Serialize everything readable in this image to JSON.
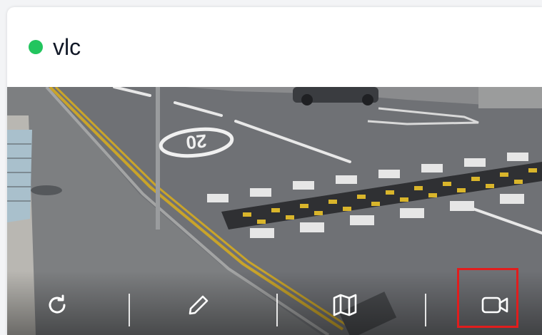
{
  "camera": {
    "name": "vlc",
    "status_color": "#22c55e"
  },
  "feed": {
    "road_marking": "20"
  },
  "toolbar": {
    "items": [
      {
        "icon": "refresh-icon"
      },
      {
        "icon": "edit-pencil-icon"
      },
      {
        "icon": "map-icon"
      },
      {
        "icon": "video-camera-icon"
      }
    ],
    "highlight_color": "#e11d1d"
  }
}
